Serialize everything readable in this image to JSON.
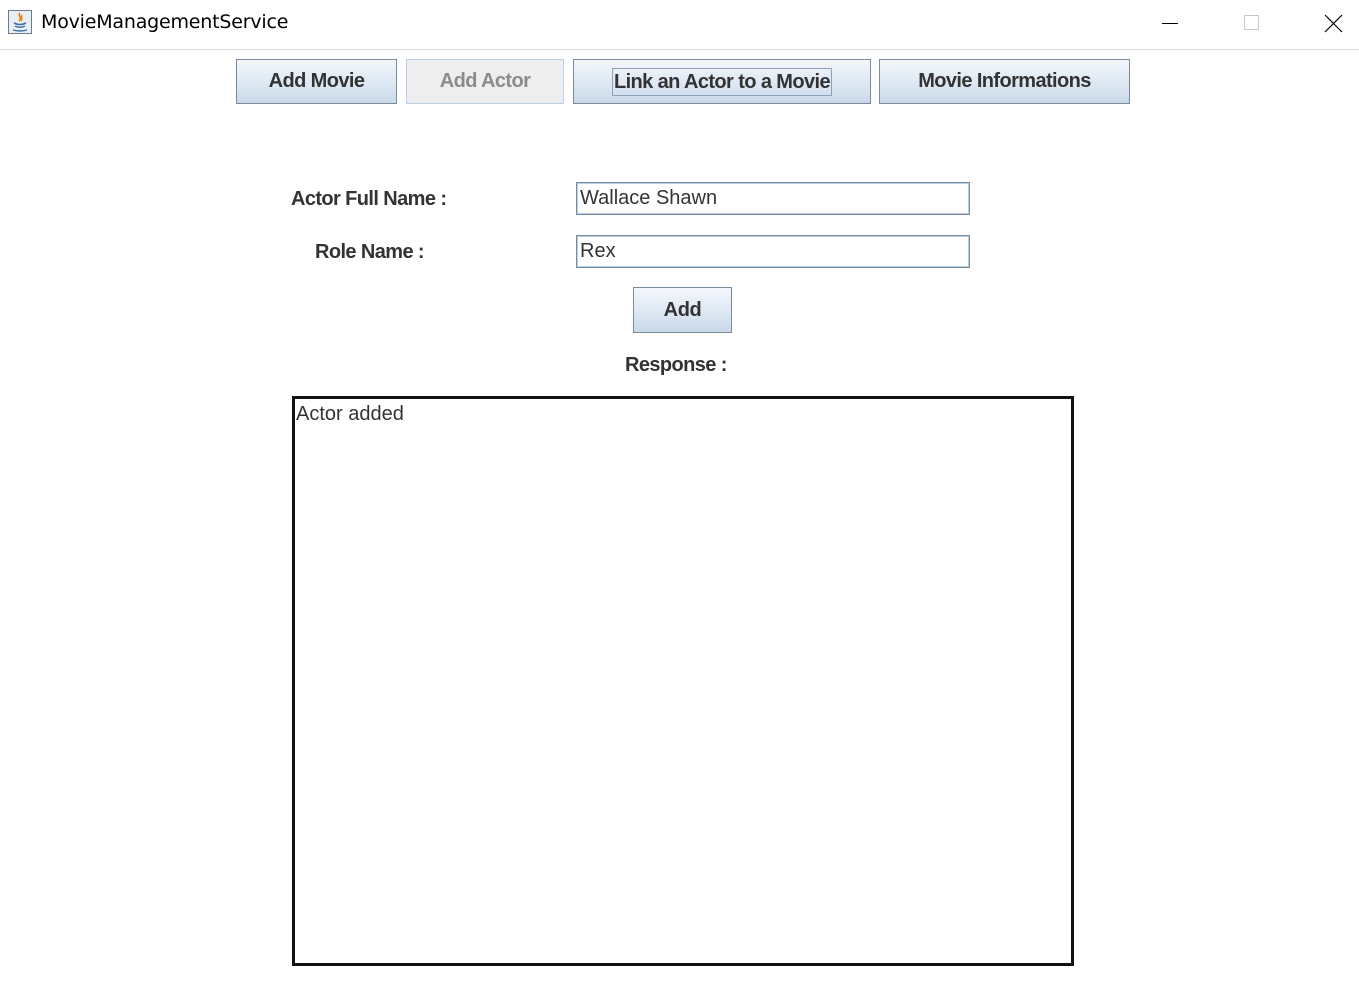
{
  "window": {
    "title": "MovieManagementService",
    "controls": {
      "minimize": "minimize-icon",
      "maximize": "maximize-icon",
      "close": "close-icon"
    }
  },
  "toolbar": {
    "add_movie_label": "Add Movie",
    "add_actor_label": "Add Actor",
    "add_actor_disabled": true,
    "link_actor_label": "Link an Actor to a Movie",
    "movie_info_label": "Movie Informations"
  },
  "form": {
    "actor_name_label": "Actor Full Name :",
    "actor_name_value": "Wallace Shawn",
    "role_name_label": "Role Name :",
    "role_name_value": "Rex",
    "add_label": "Add"
  },
  "response": {
    "label": "Response :",
    "text": "Actor added"
  },
  "colors": {
    "button_border": "#7a8a99",
    "button_gradient_top": "#f3f7fb",
    "button_gradient_bottom": "#c9d8e8",
    "text": "#333333",
    "disabled_text": "#8c8c8c"
  }
}
